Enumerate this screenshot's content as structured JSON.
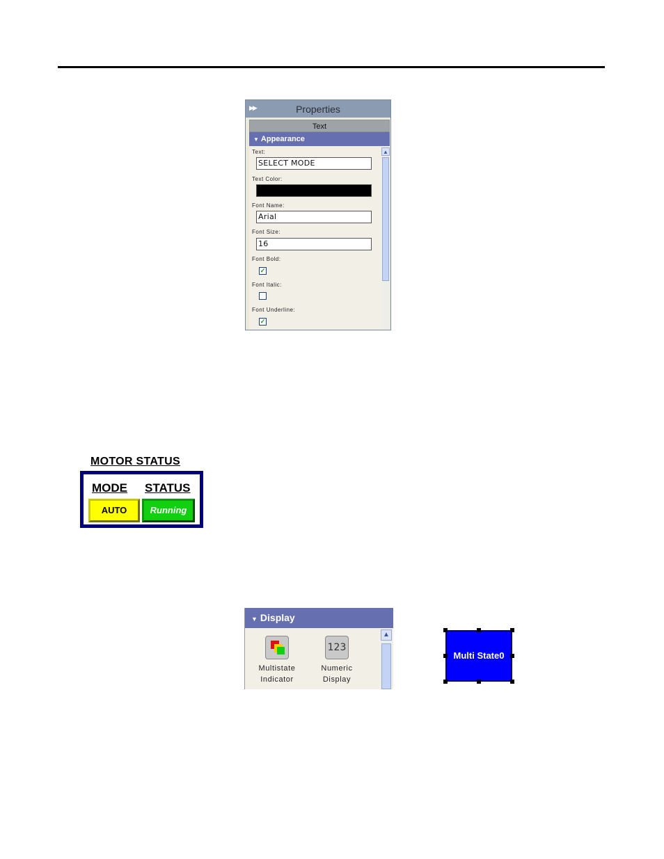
{
  "properties_panel": {
    "title": "Properties",
    "tab": "Text",
    "section": "Appearance",
    "fields": {
      "text_label": "Text:",
      "text_value": "SELECT MODE",
      "text_color_label": "Text Color:",
      "text_color_value": "#000000",
      "font_name_label": "Font Name:",
      "font_name_value": "Arial",
      "font_size_label": "Font Size:",
      "font_size_value": "16",
      "font_bold_label": "Font Bold:",
      "font_bold_checked": true,
      "font_italic_label": "Font Italic:",
      "font_italic_checked": false,
      "font_underline_label": "Font Underline:",
      "font_underline_checked": true
    }
  },
  "motor_status": {
    "title": "MOTOR STATUS",
    "mode_header": "MODE",
    "status_header": "STATUS",
    "mode_value": "AUTO",
    "status_value": "Running",
    "colors": {
      "frame": "#00007a",
      "mode": "#ffff00",
      "status": "#10d010"
    }
  },
  "display_palette": {
    "section": "Display",
    "tools": [
      {
        "line1": "Multistate",
        "line2": "Indicator",
        "icon": "multistate-indicator-icon"
      },
      {
        "line1": "Numeric",
        "line2": "Display",
        "icon": "numeric-display-icon",
        "icon_text": "123"
      }
    ]
  },
  "multistate_object": {
    "label": "Multi State0",
    "color": "#0000ff"
  }
}
